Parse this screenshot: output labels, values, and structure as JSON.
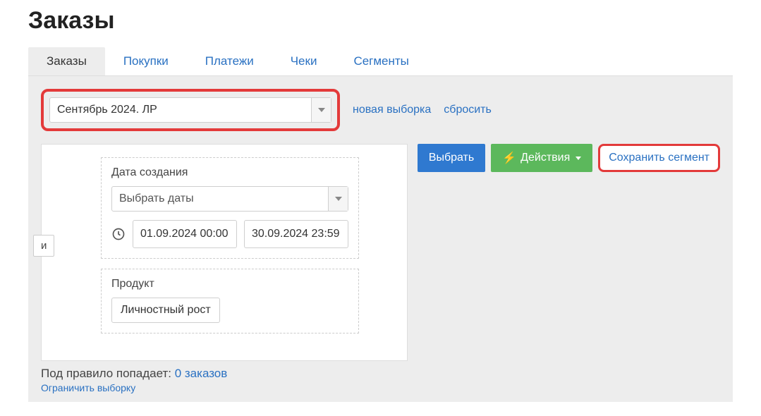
{
  "page_title": "Заказы",
  "tabs": [
    {
      "label": "Заказы",
      "active": true
    },
    {
      "label": "Покупки",
      "active": false
    },
    {
      "label": "Платежи",
      "active": false
    },
    {
      "label": "Чеки",
      "active": false
    },
    {
      "label": "Сегменты",
      "active": false
    }
  ],
  "segment_selector": {
    "value": "Сентябрь 2024. ЛР"
  },
  "links": {
    "new_selection": "новая выборка",
    "reset": "сбросить",
    "limit_selection": "Ограничить выборку"
  },
  "conjunction_label": "и",
  "rules": {
    "date_created": {
      "label": "Дата создания",
      "preset_label": "Выбрать даты",
      "from": "01.09.2024 00:00",
      "to": "30.09.2024 23:59"
    },
    "product": {
      "label": "Продукт",
      "value": "Личностный рост"
    }
  },
  "actions": {
    "select": "Выбрать",
    "actions_menu": "Действия",
    "save_segment": "Сохранить сегмент"
  },
  "summary": {
    "prefix": "Под правило попадает: ",
    "count_text": "0 заказов"
  }
}
